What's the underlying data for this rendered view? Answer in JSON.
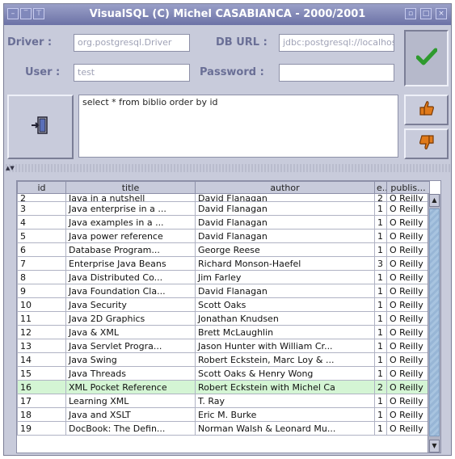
{
  "window": {
    "title": "VisualSQL (C) Michel CASABIANCA - 2000/2001"
  },
  "connection": {
    "driver_label": "Driver :",
    "driver_value": "org.postgresql.Driver",
    "url_label": "DB URL :",
    "url_value": "jdbc:postgresql://localhost/test",
    "user_label": "User :",
    "user_value": "test",
    "password_label": "Password :",
    "password_value": ""
  },
  "query": {
    "text": "select * from biblio order by id"
  },
  "icons": {
    "connect": "check-icon",
    "execute": "door-exit-icon",
    "thumbs_up": "thumbs-up-icon",
    "thumbs_down": "thumbs-down-icon",
    "colors": {
      "check": "#2e9a2e",
      "thumb": "#e07a1a",
      "selected_row": "#d4f5d4"
    }
  },
  "table": {
    "columns": [
      "id",
      "title",
      "author",
      "e...",
      "publis..."
    ],
    "rows": [
      [
        "2",
        "Java in a nutshell",
        "David Flanagan",
        "2",
        "O Reilly"
      ],
      [
        "3",
        "Java enterprise in a ...",
        "David Flanagan",
        "1",
        "O Reilly"
      ],
      [
        "4",
        "Java examples in a ...",
        "David Flanagan",
        "1",
        "O Reilly"
      ],
      [
        "5",
        "Java power reference",
        "David Flanagan",
        "1",
        "O Reilly"
      ],
      [
        "6",
        " Database Program...",
        "George Reese",
        "1",
        "O Reilly"
      ],
      [
        "7",
        "Enterprise Java Beans",
        "Richard Monson-Haefel",
        "3",
        "O Reilly"
      ],
      [
        "8",
        "Java Distributed Co...",
        "Jim Farley",
        "1",
        "O Reilly"
      ],
      [
        "9",
        "Java Foundation Cla...",
        "David Flanagan",
        "1",
        "O Reilly"
      ],
      [
        "10",
        "Java Security",
        "Scott Oaks",
        "1",
        "O Reilly"
      ],
      [
        "11",
        "Java 2D Graphics",
        "Jonathan Knudsen",
        "1",
        "O Reilly"
      ],
      [
        "12",
        "Java & XML",
        "Brett McLaughlin",
        "1",
        "O Reilly"
      ],
      [
        "13",
        "Java Servlet Progra...",
        "Jason Hunter with William Cr...",
        "1",
        "O Reilly"
      ],
      [
        "14",
        "Java Swing",
        "Robert Eckstein, Marc Loy & ...",
        "1",
        "O Reilly"
      ],
      [
        "15",
        "Java Threads",
        "Scott Oaks & Henry Wong",
        "1",
        "O Reilly"
      ],
      [
        "16",
        "XML Pocket Reference",
        "Robert Eckstein with Michel Ca",
        "2",
        "O Reilly"
      ],
      [
        "17",
        "Learning XML",
        "T. Ray",
        "1",
        "O Reilly"
      ],
      [
        "18",
        "Java and XSLT",
        "Eric M. Burke",
        "1",
        "O Reilly"
      ],
      [
        "19",
        "DocBook: The Defin...",
        "Norman Walsh & Leonard Mu...",
        "1",
        "O Reilly"
      ]
    ],
    "selected_row_index": 14
  }
}
